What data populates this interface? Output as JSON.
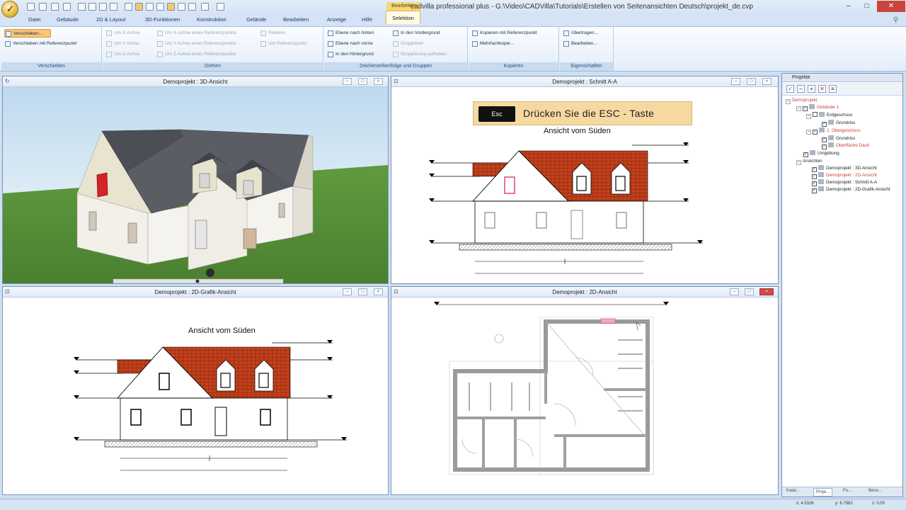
{
  "window": {
    "title": "cadvilla professional plus - G:\\Video\\CADVilla\\Tutorials\\Erstellen von Seitenansichten Deutsch\\projekt_de.cvp",
    "context_header": "Bearbeiten",
    "controls": {
      "minimize": "–",
      "maximize": "□",
      "close": "✕"
    }
  },
  "tabs": [
    "Datei",
    "Gebäude",
    "2D & Layout",
    "3D-Funktionen",
    "Konstruktion",
    "Gelände",
    "Bearbeiten",
    "Anzeige",
    "Hilfe",
    "Selektion"
  ],
  "ribbon": {
    "groups": {
      "verschieben": {
        "label": "Verschieben",
        "buttons": [
          "Verschieben...",
          "Verschieben mit Referenzpunkt"
        ]
      },
      "drehen": {
        "label": "Drehen",
        "buttons": [
          "Um X-Achse",
          "Um Y-Achse",
          "Um Z-Achse",
          "Um X-Achse eines Referenzpunkts",
          "Um Y-Achse eines Referenzpunkts",
          "Um Z-Achse eines Referenzpunkts",
          "Rotieren",
          "Um Referenzpunkt"
        ]
      },
      "zeichenreihenfolge": {
        "label": "Zeichenreihenfolge und Gruppen",
        "buttons": [
          "Ebene nach hinten",
          "Ebene nach vorne",
          "In den Hintergrund",
          "In den Vordergrund",
          "Gruppieren",
          "Gruppierung aufheben"
        ]
      },
      "kopieren": {
        "label": "Kopieren",
        "buttons": [
          "Kopieren mit Referenzpunkt",
          "Mehrfachkopie..."
        ]
      },
      "eigenschaften": {
        "label": "Eigenschaften",
        "buttons": [
          "Übertragen...",
          "Bearbeiten..."
        ]
      }
    }
  },
  "viewports": {
    "vp3d": {
      "title": "Demoprojekt : 3D-Ansicht"
    },
    "schnitt": {
      "title": "Demoprojekt : Schnitt A-A",
      "esc_key": "Esc",
      "esc_text": "Drücken Sie die ESC - Taste",
      "elevation_title": "Ansicht vom Süden"
    },
    "grafik": {
      "title": "Demoprojekt : 2D-Grafik-Ansicht",
      "elevation_title": "Ansicht vom Süden"
    },
    "plan2d": {
      "title": "Demoprojekt : 2D-Ansicht"
    }
  },
  "projects_panel": {
    "title": "Projekte",
    "tree": [
      "Demoprojekt",
      "Gebäude 1",
      "Erdgeschoss",
      "Grundriss",
      "1. Obergeschoss",
      "Grundriss",
      "Oberfläche Dach",
      "Umgebung",
      "Ansichten",
      "Demoprojekt : 3D-Ansicht",
      "Demoprojekt : 2D-Ansicht",
      "Demoprojekt : Schnitt A-A",
      "Demoprojekt : 2D-Grafik-Ansicht"
    ],
    "tabs": [
      "Katal...",
      "Proje...",
      "Fo...",
      "Beno..."
    ]
  },
  "status": {
    "x_label": "x: 4.5326",
    "y_label": "y: 6.7982",
    "z_label": "z: 0.00"
  },
  "colors": {
    "roof_red": "#c3401c",
    "roof_grey": "#55585e",
    "grass": "#4e8a35",
    "selection_pink": "#e6507a"
  }
}
